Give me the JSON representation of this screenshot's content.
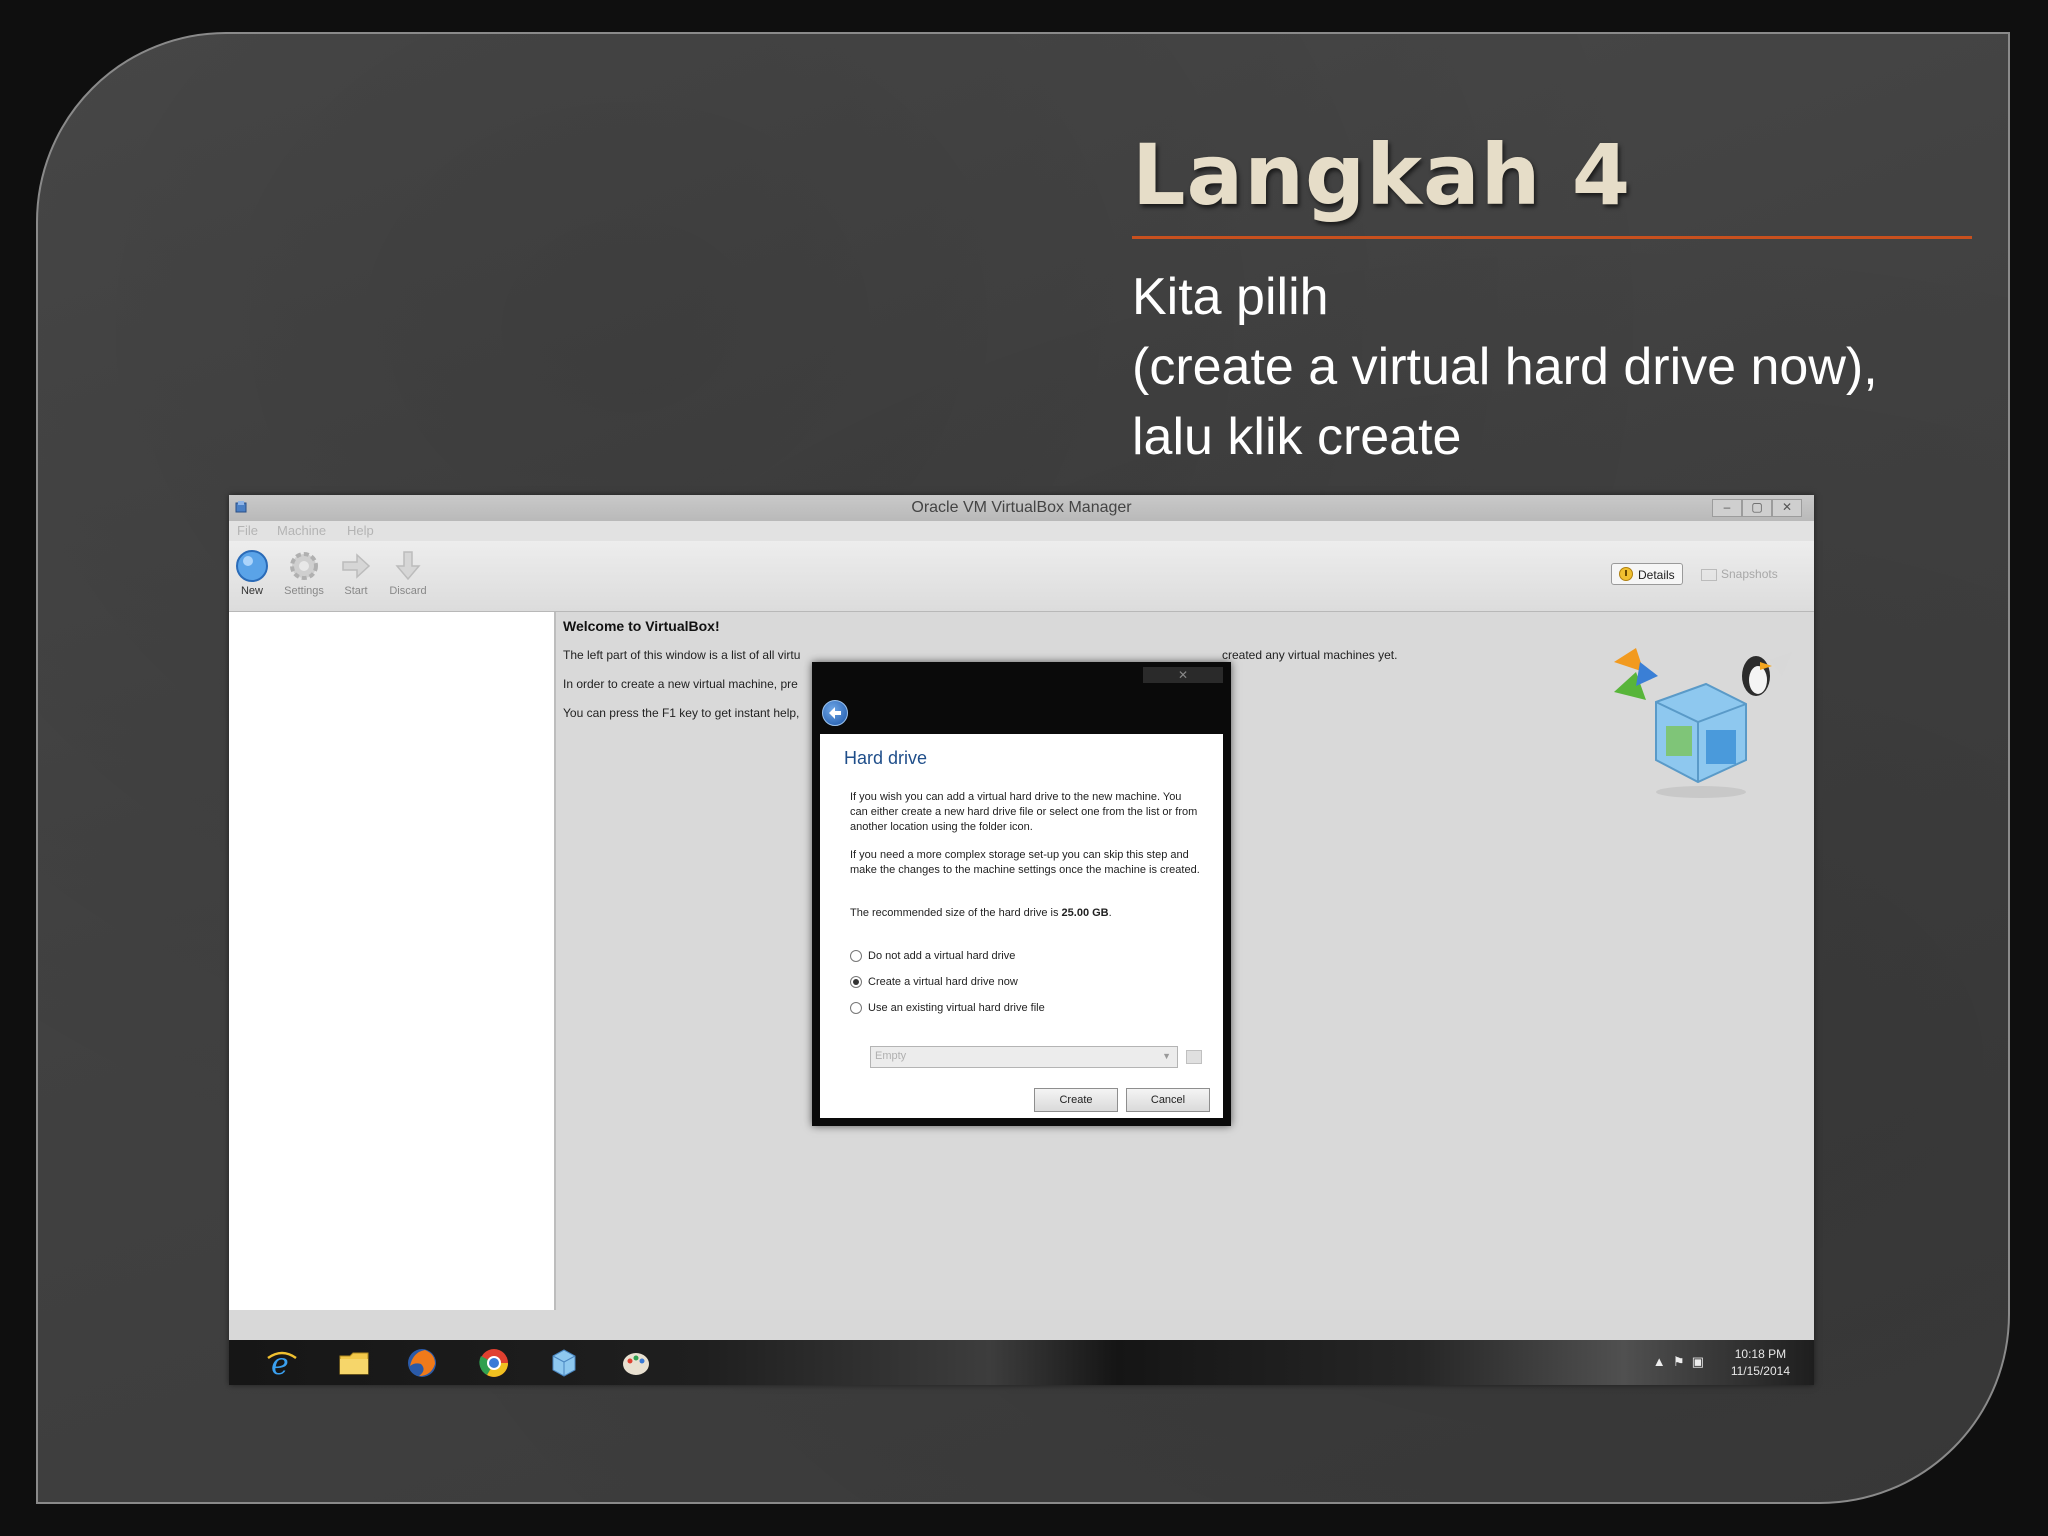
{
  "slide": {
    "title": "Langkah 4",
    "body_lines": [
      "Kita pilih",
      "(create a virtual hard drive now),",
      "lalu klik create"
    ]
  },
  "window": {
    "title": "Oracle VM VirtualBox Manager",
    "controls": [
      "–",
      "▢",
      "✕"
    ],
    "menu": [
      "File",
      "Machine",
      "Help"
    ],
    "toolbar": [
      "New",
      "Settings",
      "Start",
      "Discard"
    ],
    "view_buttons": {
      "details": "Details",
      "snapshots": "Snapshots"
    }
  },
  "welcome": {
    "heading": "Welcome to VirtualBox!",
    "line1_start": "The left part of this window is a list of all virtu",
    "line1_end": "created any virtual machines yet.",
    "line2": "In order to create a new virtual machine, pre",
    "line3": "You can press the F1 key to get instant help,"
  },
  "dialog": {
    "close": "✕",
    "title": "Hard drive",
    "para1": "If you wish you can add a virtual hard drive to the new machine. You can either create a new hard drive file or select one from the list or from another location using the folder icon.",
    "para2": "If you need a more complex storage set-up you can skip this step and make the changes to the machine settings once the machine is created.",
    "para3_prefix": "The recommended size of the hard drive is ",
    "para3_size": "25.00 GB",
    "para3_suffix": ".",
    "options": [
      "Do not add a virtual hard drive",
      "Create a virtual hard drive now",
      "Use an existing virtual hard drive file"
    ],
    "selected_option_index": 1,
    "select_value": "Empty",
    "create_button": "Create",
    "cancel_button": "Cancel"
  },
  "taskbar": {
    "time": "10:18 PM",
    "date": "11/15/2014"
  },
  "colors": {
    "title_text": "#e6ddc8",
    "title_rule": "#c8501e",
    "body_text": "#ffffff",
    "dialog_title": "#1f4e8a"
  }
}
